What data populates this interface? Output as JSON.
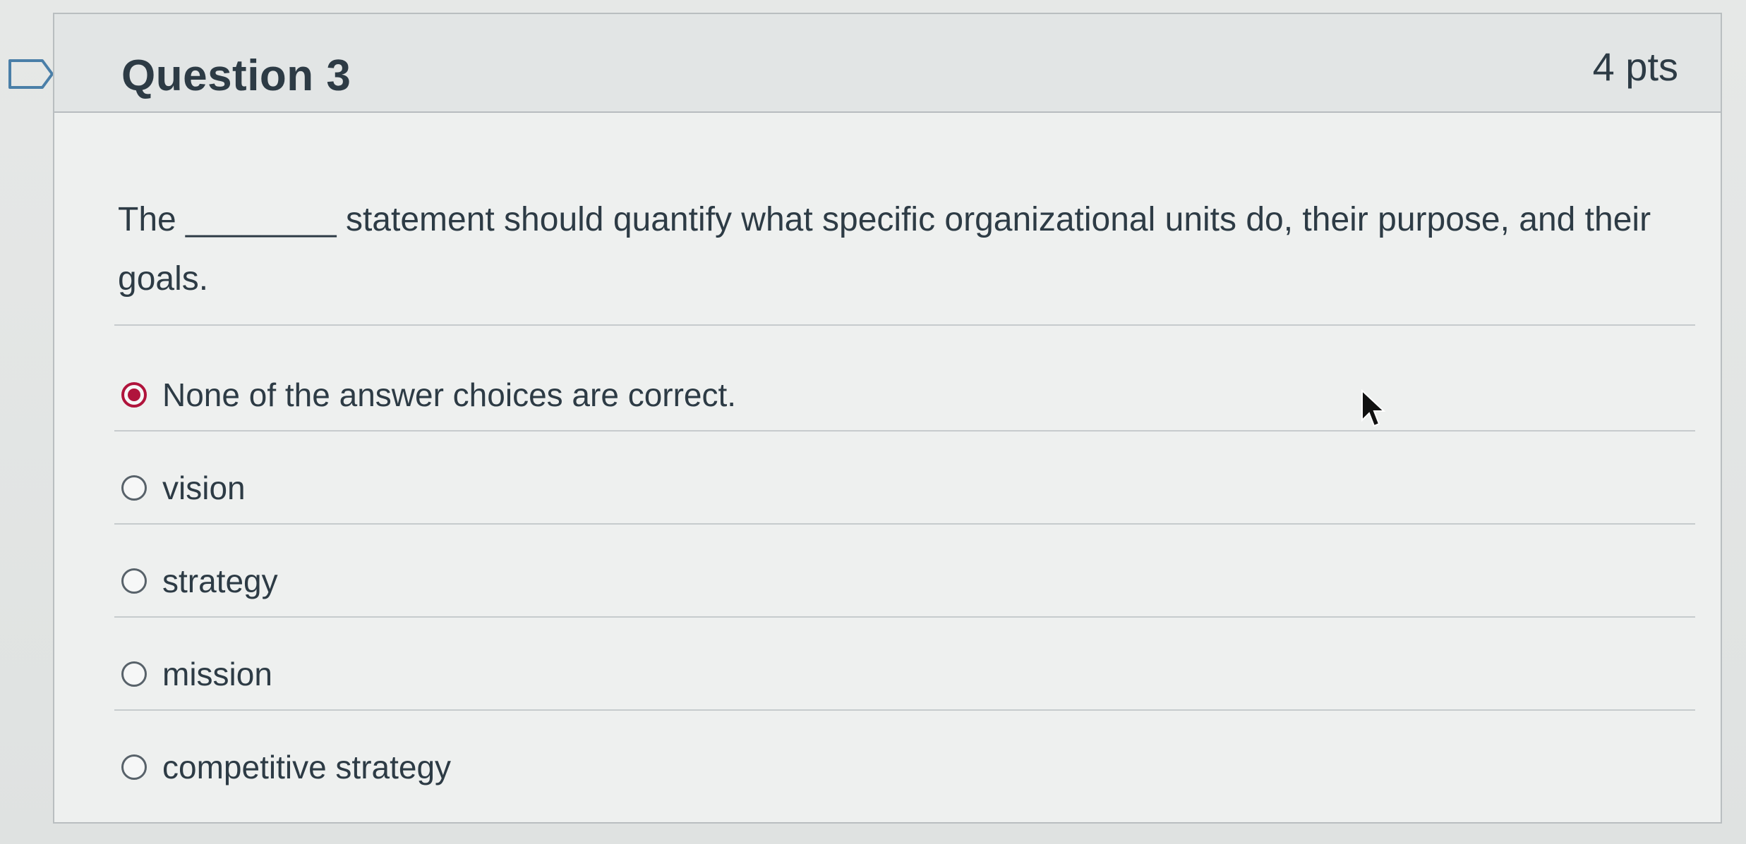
{
  "question": {
    "title": "Question 3",
    "points": "4 pts",
    "text": "The ________ statement should quantify what specific organizational units do, their purpose, and their goals."
  },
  "answers": [
    {
      "label": "None of the answer choices are correct.",
      "selected": true
    },
    {
      "label": "vision",
      "selected": false
    },
    {
      "label": "strategy",
      "selected": false
    },
    {
      "label": "mission",
      "selected": false
    },
    {
      "label": "competitive strategy",
      "selected": false
    }
  ],
  "colors": {
    "selected_radio": "#b0143c",
    "text": "#2d3b45",
    "header_bg": "#e2e5e5"
  },
  "icons": {
    "flag": "flag-outline-icon",
    "cursor": "mouse-pointer-icon"
  }
}
